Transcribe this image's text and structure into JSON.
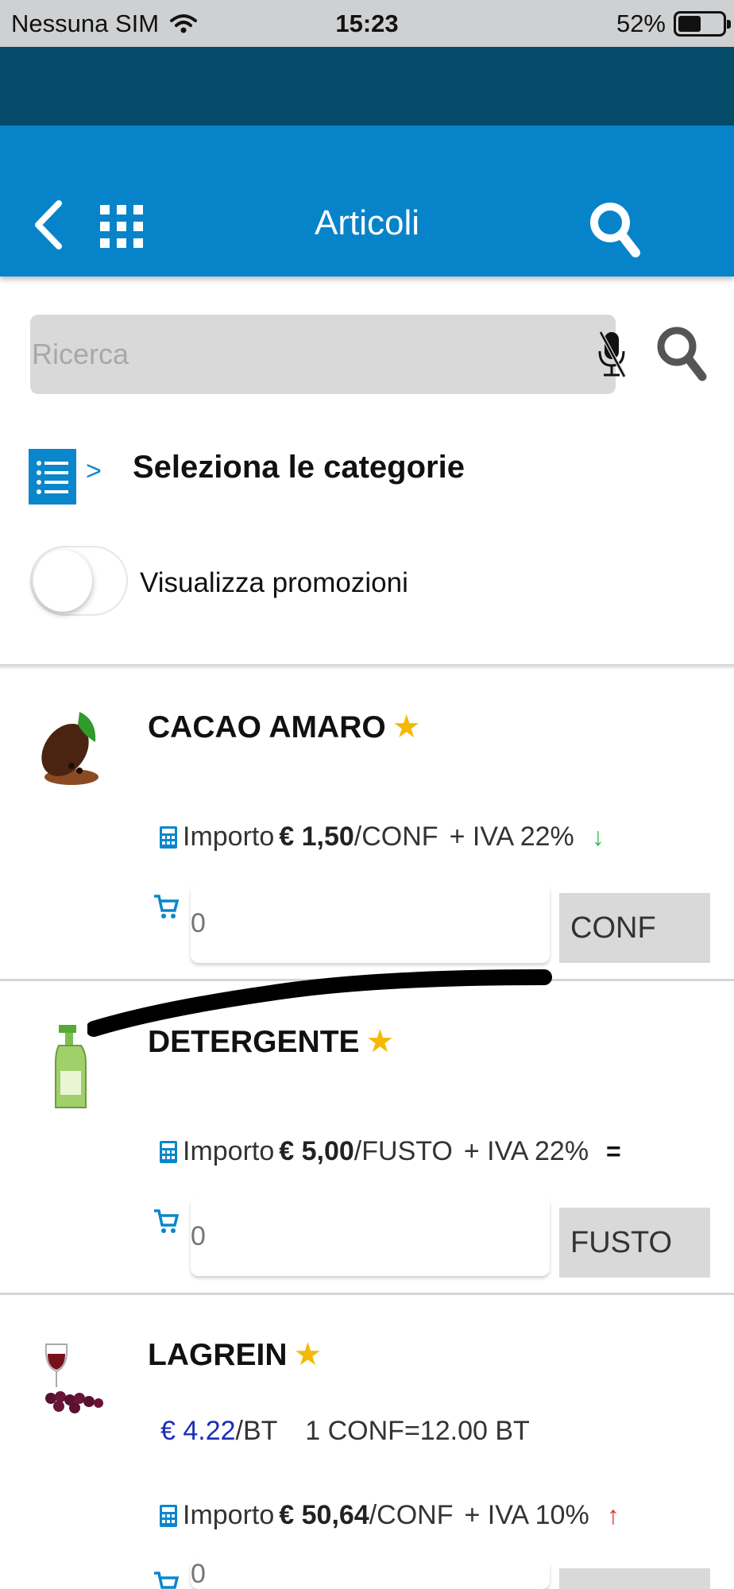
{
  "status_bar": {
    "carrier": "Nessuna SIM",
    "time": "15:23",
    "battery_text": "52%",
    "battery_level": 0.52
  },
  "header": {
    "title": "Articoli",
    "back_icon": "chevron-left-icon",
    "apps_icon": "grid-icon",
    "search_icon": "search-icon"
  },
  "search": {
    "placeholder": "Ricerca",
    "value": "",
    "mic_icon": "mic-off-icon"
  },
  "categories": {
    "arrow": ">",
    "label": "Seleziona le categorie"
  },
  "promotions_toggle": {
    "label": "Visualizza promozioni",
    "on": false
  },
  "colors": {
    "app_bar": "#0784c9",
    "dark_band": "#064a6a",
    "accent": "#0a86cc",
    "star": "#f5b800",
    "down_trend": "#2fbf4a",
    "up_trend": "#e8332a"
  },
  "products": [
    {
      "name": "CACAO AMARO",
      "star": "★",
      "price_prefix": "Importo",
      "price_amount": "€ 1,50",
      "price_unit": "/CONF",
      "vat": "+ IVA 22%",
      "trend": "↓",
      "quantity_placeholder": "0",
      "unit": "CONF"
    },
    {
      "name": "DETERGENTE",
      "star": "★",
      "price_prefix": "Importo",
      "price_amount": "€ 5,00",
      "price_unit": "/FUSTO",
      "vat": "+ IVA 22%",
      "trend": "=",
      "quantity_placeholder": "0",
      "unit": "FUSTO"
    },
    {
      "name": "LAGREIN",
      "star": "★",
      "unit_price": "€ 4.22",
      "unit_price_unit": "/BT",
      "package_info": "1 CONF=12.00 BT",
      "price_prefix": "Importo",
      "price_amount": "€ 50,64",
      "price_unit": "/CONF",
      "vat": "+ IVA 10%",
      "trend": "↑",
      "quantity_placeholder": "0"
    }
  ]
}
